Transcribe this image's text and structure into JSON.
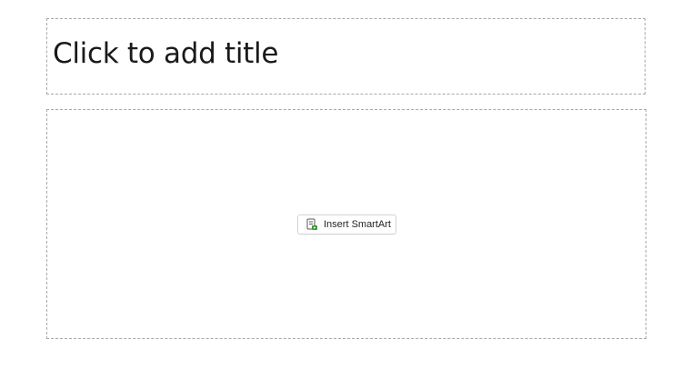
{
  "slide": {
    "title_placeholder": "Click to add title",
    "content": {
      "insert_button_label": "Insert SmartArt",
      "insert_button_icon": "smartart-insert-icon"
    }
  },
  "colors": {
    "placeholder_border": "#a8a8a8",
    "icon_green": "#3a9a3a",
    "icon_gray": "#5a5a5a"
  }
}
